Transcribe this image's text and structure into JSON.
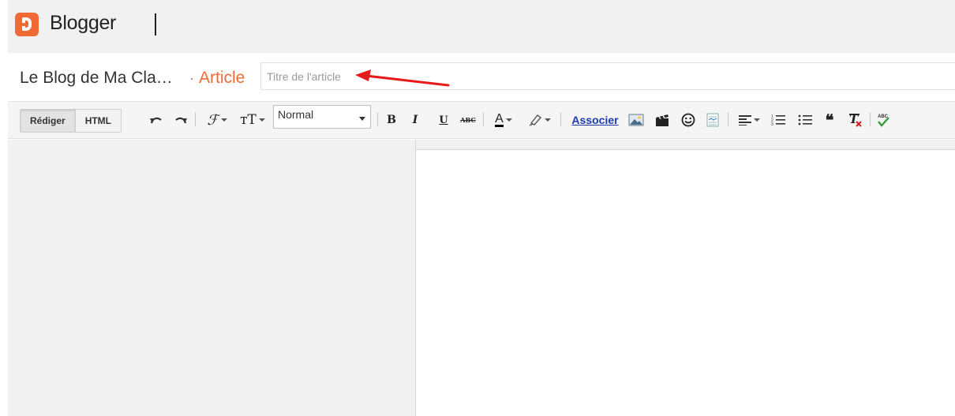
{
  "app": {
    "brand": "Blogger",
    "brand_color": "#f06a35"
  },
  "post": {
    "blog_name": "Le Blog de Ma Cla…",
    "separator": "·",
    "kind_label": "Article",
    "title_placeholder": "Titre de l'article",
    "title_value": ""
  },
  "toolbar": {
    "compose_label": "Rédiger",
    "html_label": "HTML",
    "format_value": "Normal",
    "bold": "B",
    "italic": "I",
    "underline": "U",
    "strike": "ABC",
    "text_color_glyph": "A",
    "link_label": "Associer",
    "font_glyph": "ℱ",
    "size_glyph": "тT",
    "icons": [
      "undo-icon",
      "redo-icon",
      "font-family-icon",
      "font-size-icon",
      "text-color-icon",
      "highlight-icon",
      "image-icon",
      "video-icon",
      "emoji-icon",
      "jump-break-icon",
      "align-icon",
      "numbered-list-icon",
      "bullet-list-icon",
      "quote-icon",
      "clear-format-icon",
      "spellcheck-icon"
    ]
  },
  "annotation": {
    "arrow_color": "#e8191a"
  }
}
